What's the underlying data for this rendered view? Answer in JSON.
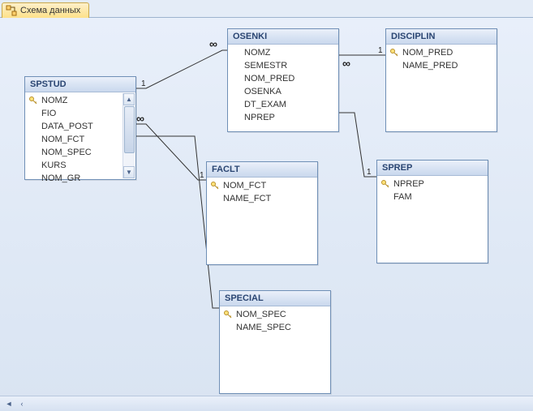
{
  "tab": {
    "title": "Схема данных"
  },
  "tables": {
    "spstud": {
      "title": "SPSTUD",
      "fields": [
        "NOMZ",
        "FIO",
        "DATA_POST",
        "NOM_FCT",
        "NOM_SPEC",
        "KURS",
        "NOM_GR"
      ]
    },
    "osenki": {
      "title": "OSENKI",
      "fields": [
        "NOMZ",
        "SEMESTR",
        "NOM_PRED",
        "OSENKA",
        "DT_EXAM",
        "NPREP"
      ]
    },
    "disciplin": {
      "title": "DISCIPLIN",
      "fields": [
        "NOM_PRED",
        "NAME_PRED"
      ]
    },
    "faclt": {
      "title": "FACLT",
      "fields": [
        "NOM_FCT",
        "NAME_FCT"
      ]
    },
    "sprep": {
      "title": "SPREP",
      "fields": [
        "NPREP",
        "FAM"
      ]
    },
    "special": {
      "title": "SPECIAL",
      "fields": [
        "NOM_SPEC",
        "NAME_SPEC"
      ]
    }
  }
}
